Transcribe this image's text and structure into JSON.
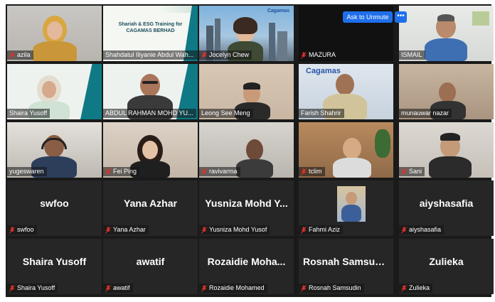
{
  "meeting": {
    "ask_to_unmute": "Ask to Unmute",
    "more_label": "•••",
    "slide_title": "Shariah & ESG Training for CAGAMAS BERHAD",
    "slide_brand": "Cagamas"
  },
  "tiles": [
    {
      "name": "azila"
    },
    {
      "name": "Shahdatul Iliyanie Abdul Wah..."
    },
    {
      "name": "Jocelyn Chew"
    },
    {
      "name": "MAZURA"
    },
    {
      "name": "ISMAIL"
    },
    {
      "name": "Shaira Yusoff"
    },
    {
      "name": "ABDUL RAHMAN MOHD YU..."
    },
    {
      "name": "Leong See Meng"
    },
    {
      "name": "Farish Shahrir"
    },
    {
      "name": "munauwar nazar"
    },
    {
      "name": "yugeswaren"
    },
    {
      "name": "Fei Ping"
    },
    {
      "name": "ravivarma"
    },
    {
      "name": "tclim"
    },
    {
      "name": "Sani"
    },
    {
      "name": "swfoo",
      "display": "swfoo"
    },
    {
      "name": "Yana Azhar",
      "display": "Yana Azhar"
    },
    {
      "name": "Yusniza Mohd Yusof",
      "display": "Yusniza Mohd Y..."
    },
    {
      "name": "Fahmi Aziz"
    },
    {
      "name": "aiyshasafia",
      "display": "aiyshasafia"
    },
    {
      "name": "Shaira Yusoff",
      "display": "Shaira Yusoff"
    },
    {
      "name": "awatif",
      "display": "awatif"
    },
    {
      "name": "Rozaidie Mohamed",
      "display": "Rozaidie Moha..."
    },
    {
      "name": "Rosnah Samsudin",
      "display": "Rosnah Samsudin"
    },
    {
      "name": "Zulieka",
      "display": "Zulieka"
    }
  ],
  "colors": {
    "muted_mic": "#e0302a",
    "unmute_button": "#1f6feb",
    "active_speaker_border": "#d9c43a"
  }
}
